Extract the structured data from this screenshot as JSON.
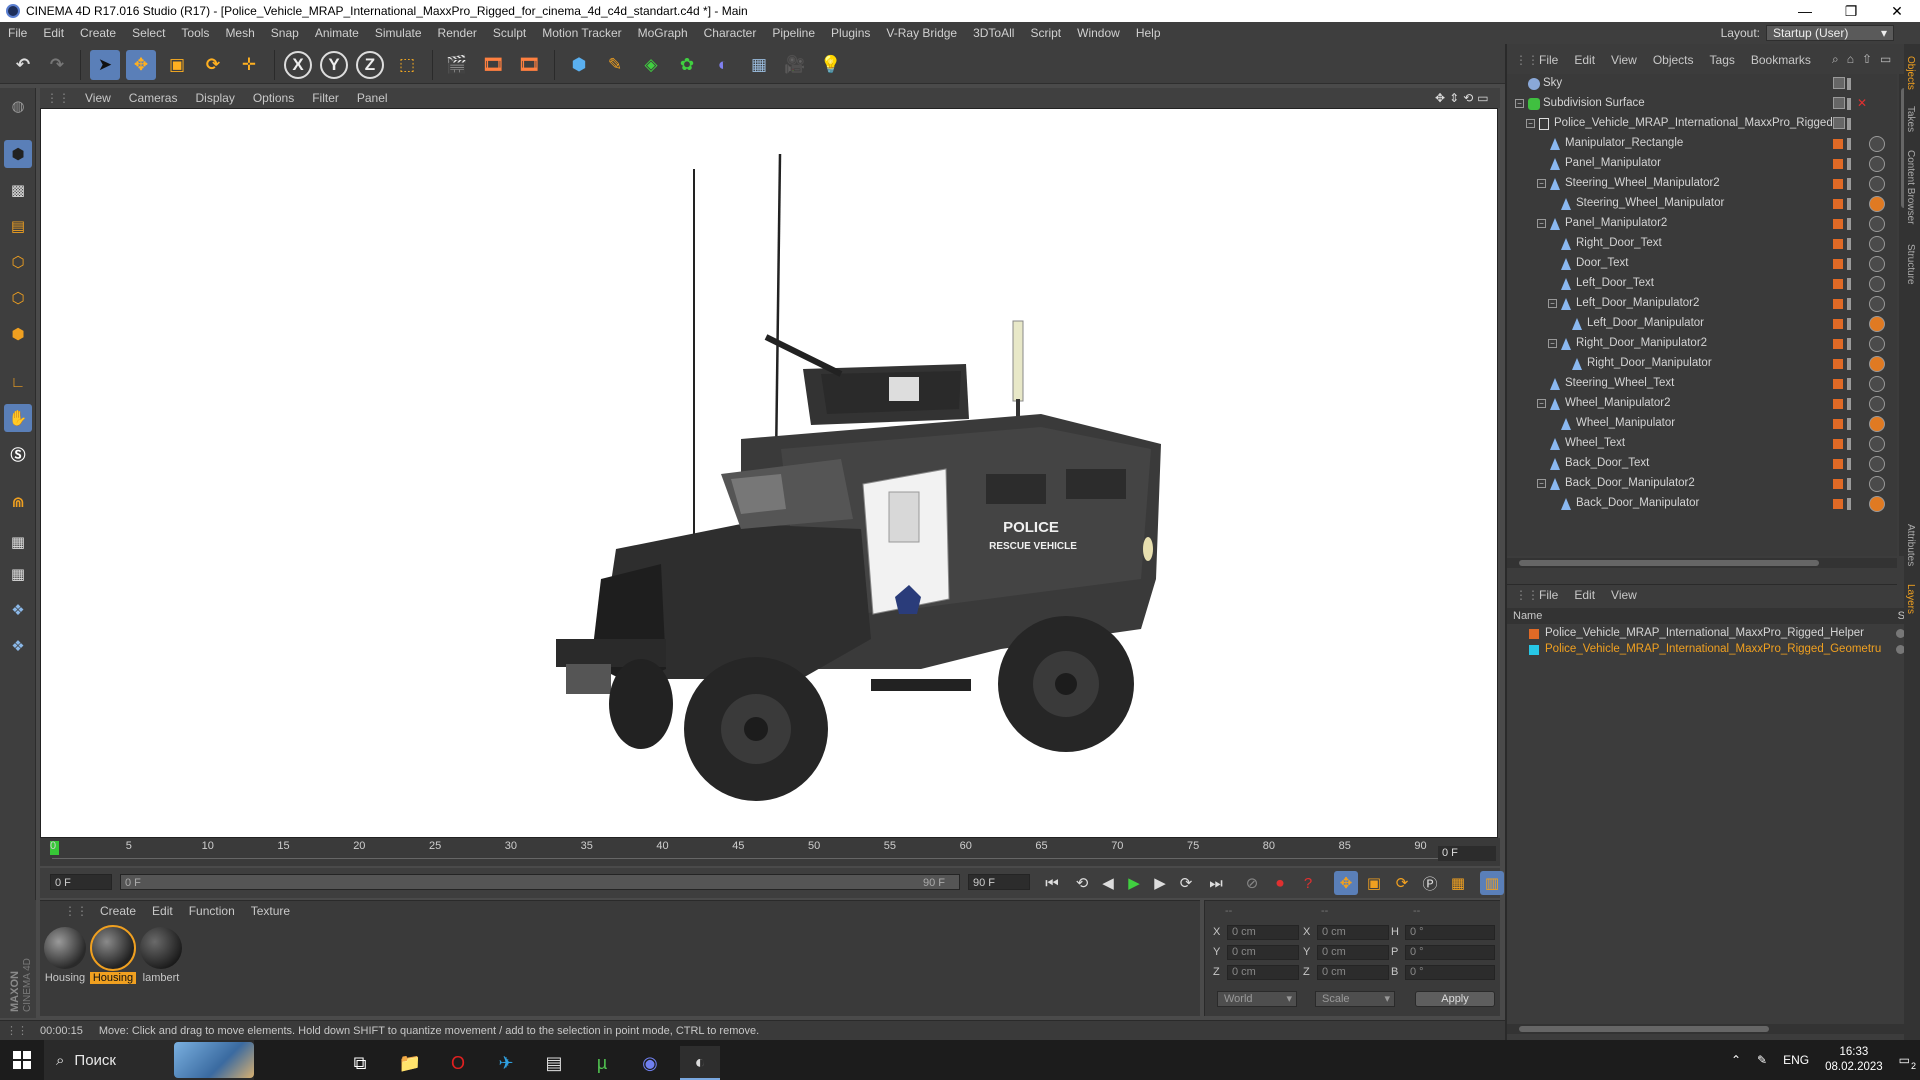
{
  "window": {
    "title": "CINEMA 4D R17.016 Studio (R17) - [Police_Vehicle_MRAP_International_MaxxPro_Rigged_for_cinema_4d_c4d_standart.c4d *] - Main",
    "minimize": "—",
    "maximize": "❐",
    "close": "✕"
  },
  "menubar": {
    "items": [
      "File",
      "Edit",
      "Create",
      "Select",
      "Tools",
      "Mesh",
      "Snap",
      "Animate",
      "Simulate",
      "Render",
      "Sculpt",
      "Motion Tracker",
      "MoGraph",
      "Character",
      "Pipeline",
      "Plugins",
      "V-Ray Bridge",
      "3DToAll",
      "Script",
      "Window",
      "Help"
    ],
    "layout_label": "Layout:",
    "layout_value": "Startup (User)"
  },
  "toolbar": {
    "undo_icon": "undo-icon",
    "x_label": "X",
    "y_label": "Y",
    "z_label": "Z"
  },
  "viewport": {
    "menu": [
      "View",
      "Cameras",
      "Display",
      "Options",
      "Filter",
      "Panel"
    ],
    "vehicle_text_1": "POLICE",
    "vehicle_text_2": "RESCUE VEHICLE"
  },
  "timeline": {
    "ticks": [
      "0",
      "5",
      "10",
      "15",
      "20",
      "25",
      "30",
      "35",
      "40",
      "45",
      "50",
      "55",
      "60",
      "65",
      "70",
      "75",
      "80",
      "85",
      "90"
    ],
    "current_frame": "0 F",
    "start_field": "0 F",
    "range_start": "0 F",
    "range_end": "90 F",
    "end_field": "90 F"
  },
  "materials": {
    "menu": [
      "Create",
      "Edit",
      "Function",
      "Texture"
    ],
    "items": [
      {
        "label": "Housing"
      },
      {
        "label": "Housing"
      },
      {
        "label": "lambert"
      }
    ]
  },
  "coordinates": {
    "dashes": [
      "--",
      "--",
      "--"
    ],
    "rows": [
      {
        "a": "X",
        "av": "0 cm",
        "b": "X",
        "bv": "0 cm",
        "c": "H",
        "cv": "0 °"
      },
      {
        "a": "Y",
        "av": "0 cm",
        "b": "Y",
        "bv": "0 cm",
        "c": "P",
        "cv": "0 °"
      },
      {
        "a": "Z",
        "av": "0 cm",
        "b": "Z",
        "bv": "0 cm",
        "c": "B",
        "cv": "0 °"
      }
    ],
    "world": "World",
    "scale": "Scale",
    "apply": "Apply"
  },
  "status": {
    "time": "00:00:15",
    "message": "Move: Click and drag to move elements. Hold down SHIFT to quantize movement / add to the selection in point mode, CTRL to remove."
  },
  "object_manager": {
    "menu": [
      "File",
      "Edit",
      "View",
      "Objects",
      "Tags",
      "Bookmarks"
    ],
    "objects": [
      {
        "name": "Sky",
        "indent": 0,
        "tree": "",
        "type": "sky"
      },
      {
        "name": "Subdivision Surface",
        "indent": 0,
        "tree": "−",
        "type": "subd"
      },
      {
        "name": "Police_Vehicle_MRAP_International_MaxxPro_Rigged",
        "indent": 1,
        "tree": "−",
        "type": "null"
      },
      {
        "name": "Manipulator_Rectangle",
        "indent": 2,
        "tree": "",
        "type": "joint"
      },
      {
        "name": "Panel_Manipulator",
        "indent": 2,
        "tree": "",
        "type": "joint"
      },
      {
        "name": "Steering_Wheel_Manipulator2",
        "indent": 2,
        "tree": "−",
        "type": "joint"
      },
      {
        "name": "Steering_Wheel_Manipulator",
        "indent": 3,
        "tree": "",
        "type": "joint"
      },
      {
        "name": "Panel_Manipulator2",
        "indent": 2,
        "tree": "−",
        "type": "joint"
      },
      {
        "name": "Right_Door_Text",
        "indent": 3,
        "tree": "",
        "type": "joint"
      },
      {
        "name": "Door_Text",
        "indent": 3,
        "tree": "",
        "type": "joint"
      },
      {
        "name": "Left_Door_Text",
        "indent": 3,
        "tree": "",
        "type": "joint"
      },
      {
        "name": "Left_Door_Manipulator2",
        "indent": 3,
        "tree": "−",
        "type": "joint"
      },
      {
        "name": "Left_Door_Manipulator",
        "indent": 4,
        "tree": "",
        "type": "joint"
      },
      {
        "name": "Right_Door_Manipulator2",
        "indent": 3,
        "tree": "−",
        "type": "joint"
      },
      {
        "name": "Right_Door_Manipulator",
        "indent": 4,
        "tree": "",
        "type": "joint"
      },
      {
        "name": "Steering_Wheel_Text",
        "indent": 2,
        "tree": "",
        "type": "joint"
      },
      {
        "name": "Wheel_Manipulator2",
        "indent": 2,
        "tree": "−",
        "type": "joint"
      },
      {
        "name": "Wheel_Manipulator",
        "indent": 3,
        "tree": "",
        "type": "joint"
      },
      {
        "name": "Wheel_Text",
        "indent": 2,
        "tree": "",
        "type": "joint"
      },
      {
        "name": "Back_Door_Text",
        "indent": 2,
        "tree": "",
        "type": "joint"
      },
      {
        "name": "Back_Door_Manipulator2",
        "indent": 2,
        "tree": "−",
        "type": "joint"
      },
      {
        "name": "Back_Door_Manipulator",
        "indent": 3,
        "tree": "",
        "type": "joint"
      }
    ]
  },
  "layer_manager": {
    "menu": [
      "File",
      "Edit",
      "View"
    ],
    "header": "Name",
    "header_s": "S",
    "layers": [
      {
        "name": "Police_Vehicle_MRAP_International_MaxxPro_Rigged_Helper",
        "color": "#e06a26",
        "highlight": false
      },
      {
        "name": "Police_Vehicle_MRAP_International_MaxxPro_Rigged_Geometru",
        "color": "#27c7e6",
        "highlight": true
      }
    ]
  },
  "side_tabs": [
    "Objects",
    "Takes",
    "Content Browser",
    "Structure",
    "Attributes",
    "Layers"
  ],
  "taskbar": {
    "search_placeholder": "Поиск",
    "language": "ENG",
    "time": "16:33",
    "date": "08.02.2023",
    "notifications": "2"
  },
  "colors": {
    "accent": "#5a7fb8",
    "orange": "#e06a26",
    "highlight_text": "#f0a020"
  }
}
